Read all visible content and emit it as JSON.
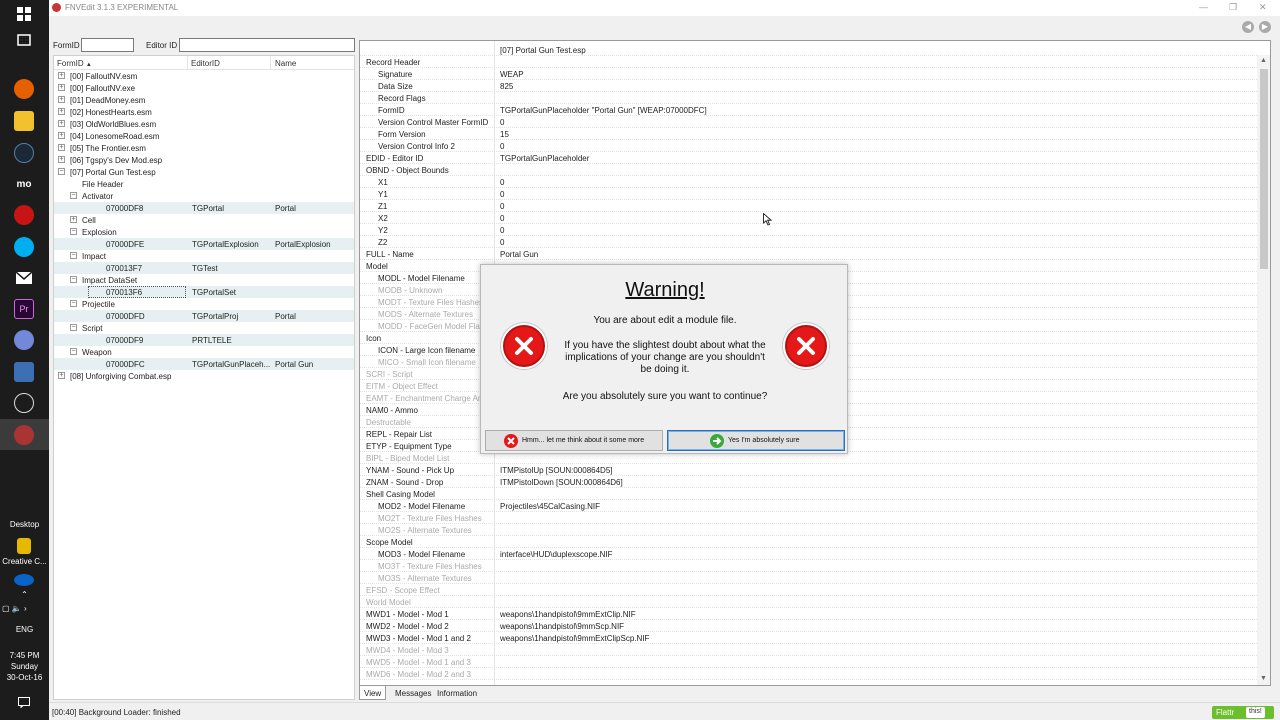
{
  "taskbar": {
    "desktop_label": "Desktop",
    "creative_label": "Creative C...",
    "language": "ENG",
    "time": "7:45 PM",
    "day": "Sunday",
    "date": "30-Oct-16",
    "chevron_up": "⌃",
    "chevron_right": "›"
  },
  "window": {
    "title": "FNVEdit 3.1.3 EXPERIMENTAL",
    "minimize": "—",
    "maximize": "❐",
    "close": "✕"
  },
  "toolbar": {
    "back": "◀",
    "forward": "▶"
  },
  "filter": {
    "formid_label": "FormID",
    "editorid_label": "Editor ID",
    "formid_value": "",
    "editorid_value": ""
  },
  "tree": {
    "columns": [
      "FormID",
      "EditorID",
      "Name"
    ],
    "sort_indicator": "▲",
    "rows": [
      {
        "exp": "+",
        "text": "[00] FalloutNV.esm",
        "editorid": "",
        "name": "",
        "level": 0
      },
      {
        "exp": "+",
        "text": "[00] FalloutNV.exe",
        "editorid": "",
        "name": "",
        "level": 0
      },
      {
        "exp": "+",
        "text": "[01] DeadMoney.esm",
        "editorid": "",
        "name": "",
        "level": 0
      },
      {
        "exp": "+",
        "text": "[02] HonestHearts.esm",
        "editorid": "",
        "name": "",
        "level": 0
      },
      {
        "exp": "+",
        "text": "[03] OldWorldBlues.esm",
        "editorid": "",
        "name": "",
        "level": 0
      },
      {
        "exp": "+",
        "text": "[04] LonesomeRoad.esm",
        "editorid": "",
        "name": "",
        "level": 0
      },
      {
        "exp": "+",
        "text": "[05] The Frontier.esm",
        "editorid": "",
        "name": "",
        "level": 0
      },
      {
        "exp": "+",
        "text": "[06] Tgspy's Dev Mod.esp",
        "editorid": "",
        "name": "",
        "level": 0
      },
      {
        "exp": "−",
        "text": "[07] Portal Gun Test.esp",
        "editorid": "",
        "name": "",
        "level": 0
      },
      {
        "exp": "",
        "text": "File Header",
        "editorid": "",
        "name": "",
        "level": 1
      },
      {
        "exp": "−",
        "text": "Activator",
        "editorid": "",
        "name": "",
        "level": 1
      },
      {
        "exp": "",
        "text": "07000DF8",
        "editorid": "TGPortal",
        "name": "Portal",
        "level": 2,
        "hl": true
      },
      {
        "exp": "+",
        "text": "Cell",
        "editorid": "",
        "name": "",
        "level": 1
      },
      {
        "exp": "−",
        "text": "Explosion",
        "editorid": "",
        "name": "",
        "level": 1
      },
      {
        "exp": "",
        "text": "07000DFE",
        "editorid": "TGPortalExplosion",
        "name": "PortalExplosion",
        "level": 2,
        "hl": true
      },
      {
        "exp": "−",
        "text": "Impact",
        "editorid": "",
        "name": "",
        "level": 1
      },
      {
        "exp": "",
        "text": "070013F7",
        "editorid": "TGTest",
        "name": "",
        "level": 2,
        "hl": true
      },
      {
        "exp": "−",
        "text": "Impact DataSet",
        "editorid": "",
        "name": "",
        "level": 1
      },
      {
        "exp": "",
        "text": "070013F6",
        "editorid": "TGPortalSet",
        "name": "",
        "level": 2,
        "hl": true,
        "focus": true
      },
      {
        "exp": "−",
        "text": "Projectile",
        "editorid": "",
        "name": "",
        "level": 1
      },
      {
        "exp": "",
        "text": "07000DFD",
        "editorid": "TGPortalProj",
        "name": "Portal",
        "level": 2,
        "hl": true
      },
      {
        "exp": "−",
        "text": "Script",
        "editorid": "",
        "name": "",
        "level": 1
      },
      {
        "exp": "",
        "text": "07000DF9",
        "editorid": "PRTLTELE",
        "name": "",
        "level": 2,
        "hl": true
      },
      {
        "exp": "−",
        "text": "Weapon",
        "editorid": "",
        "name": "",
        "level": 1
      },
      {
        "exp": "",
        "text": "07000DFC",
        "editorid": "TGPortalGunPlaceh...",
        "name": "Portal Gun",
        "level": 2,
        "hl": true
      },
      {
        "exp": "+",
        "text": "[08] Unforgiving Combat.esp",
        "editorid": "",
        "name": "",
        "level": 0
      }
    ]
  },
  "record": {
    "rows": [
      {
        "label": "",
        "value": "[07] Portal Gun Test.esp",
        "level": 0,
        "dim": false
      },
      {
        "label": "Record Header",
        "value": "",
        "level": 0,
        "dim": false
      },
      {
        "label": "Signature",
        "value": "WEAP",
        "level": 1,
        "dim": false
      },
      {
        "label": "Data Size",
        "value": "825",
        "level": 1,
        "dim": false
      },
      {
        "label": "Record Flags",
        "value": "",
        "level": 1,
        "dim": false
      },
      {
        "label": "FormID",
        "value": "TGPortalGunPlaceholder \"Portal Gun\" [WEAP:07000DFC]",
        "level": 1,
        "dim": false
      },
      {
        "label": "Version Control Master FormID",
        "value": "0",
        "level": 1,
        "dim": false
      },
      {
        "label": "Form Version",
        "value": "15",
        "level": 1,
        "dim": false
      },
      {
        "label": "Version Control Info 2",
        "value": "0",
        "level": 1,
        "dim": false
      },
      {
        "label": "EDID - Editor ID",
        "value": "TGPortalGunPlaceholder",
        "level": 0,
        "dim": false
      },
      {
        "label": "OBND - Object Bounds",
        "value": "",
        "level": 0,
        "dim": false
      },
      {
        "label": "X1",
        "value": "0",
        "level": 1,
        "dim": false
      },
      {
        "label": "Y1",
        "value": "0",
        "level": 1,
        "dim": false
      },
      {
        "label": "Z1",
        "value": "0",
        "level": 1,
        "dim": false
      },
      {
        "label": "X2",
        "value": "0",
        "level": 1,
        "dim": false
      },
      {
        "label": "Y2",
        "value": "0",
        "level": 1,
        "dim": false
      },
      {
        "label": "Z2",
        "value": "0",
        "level": 1,
        "dim": false
      },
      {
        "label": "FULL - Name",
        "value": "Portal Gun",
        "level": 0,
        "dim": false
      },
      {
        "label": "Model",
        "value": "",
        "level": 0,
        "dim": false
      },
      {
        "label": "MODL - Model Filename",
        "value": "",
        "level": 1,
        "dim": false
      },
      {
        "label": "MODB - Unknown",
        "value": "",
        "level": 1,
        "dim": true
      },
      {
        "label": "MODT - Texture Files Hashes",
        "value": "",
        "level": 1,
        "dim": true
      },
      {
        "label": "MODS - Alternate Textures",
        "value": "",
        "level": 1,
        "dim": true
      },
      {
        "label": "MODD - FaceGen Model Flags",
        "value": "",
        "level": 1,
        "dim": true
      },
      {
        "label": "Icon",
        "value": "",
        "level": 0,
        "dim": false
      },
      {
        "label": "ICON - Large Icon filename",
        "value": "",
        "level": 1,
        "dim": false
      },
      {
        "label": "MICO - Small Icon filename",
        "value": "",
        "level": 1,
        "dim": true
      },
      {
        "label": "SCRI - Script",
        "value": "",
        "level": 0,
        "dim": true
      },
      {
        "label": "EITM - Object Effect",
        "value": "",
        "level": 0,
        "dim": true
      },
      {
        "label": "EAMT - Enchantment Charge Amount",
        "value": "",
        "level": 0,
        "dim": true
      },
      {
        "label": "NAM0 - Ammo",
        "value": "",
        "level": 0,
        "dim": false
      },
      {
        "label": "Destructable",
        "value": "",
        "level": 0,
        "dim": true
      },
      {
        "label": "REPL - Repair List",
        "value": "",
        "level": 0,
        "dim": false
      },
      {
        "label": "ETYP - Equipment Type",
        "value": "",
        "level": 0,
        "dim": false
      },
      {
        "label": "BIPL - Biped Model List",
        "value": "",
        "level": 0,
        "dim": true
      },
      {
        "label": "YNAM - Sound - Pick Up",
        "value": "ITMPistolUp [SOUN:000864D5]",
        "level": 0,
        "dim": false
      },
      {
        "label": "ZNAM - Sound - Drop",
        "value": "ITMPistolDown [SOUN:000864D6]",
        "level": 0,
        "dim": false
      },
      {
        "label": "Shell Casing Model",
        "value": "",
        "level": 0,
        "dim": false
      },
      {
        "label": "MOD2 - Model Filename",
        "value": "Projectiles\\45CalCasing.NIF",
        "level": 1,
        "dim": false
      },
      {
        "label": "MO2T - Texture Files Hashes",
        "value": "",
        "level": 1,
        "dim": true
      },
      {
        "label": "MO2S - Alternate Textures",
        "value": "",
        "level": 1,
        "dim": true
      },
      {
        "label": "Scope Model",
        "value": "",
        "level": 0,
        "dim": false
      },
      {
        "label": "MOD3 - Model Filename",
        "value": "interface\\HUD\\duplexscope.NIF",
        "level": 1,
        "dim": false
      },
      {
        "label": "MO3T - Texture Files Hashes",
        "value": "",
        "level": 1,
        "dim": true
      },
      {
        "label": "MO3S - Alternate Textures",
        "value": "",
        "level": 1,
        "dim": true
      },
      {
        "label": "EFSD - Scope Effect",
        "value": "",
        "level": 0,
        "dim": true
      },
      {
        "label": "World Model",
        "value": "",
        "level": 0,
        "dim": true
      },
      {
        "label": "MWD1 - Model - Mod 1",
        "value": "weapons\\1handpistol\\9mmExtClip.NIF",
        "level": 0,
        "dim": false
      },
      {
        "label": "MWD2 - Model - Mod 2",
        "value": "weapons\\1handpistol\\9mmScp.NIF",
        "level": 0,
        "dim": false
      },
      {
        "label": "MWD3 - Model - Mod 1 and 2",
        "value": "weapons\\1handpistol\\9mmExtClipScp.NIF",
        "level": 0,
        "dim": false
      },
      {
        "label": "MWD4 - Model - Mod 3",
        "value": "",
        "level": 0,
        "dim": true
      },
      {
        "label": "MWD5 - Model - Mod 1 and 3",
        "value": "",
        "level": 0,
        "dim": true
      },
      {
        "label": "MWD6 - Model - Mod 2 and 3",
        "value": "",
        "level": 0,
        "dim": true
      }
    ]
  },
  "tabs": [
    "View",
    "Messages",
    "Information"
  ],
  "status": {
    "text": "[00:40] Background Loader: finished",
    "flattr_label": "Flattr",
    "flattr_this": "this!"
  },
  "dialog": {
    "title": "Warning!",
    "line1": "You are about edit a module file.",
    "line2": "If you have the slightest doubt about what the implications of your change are you shouldn't be doing it.",
    "line3": "Are you absolutely sure you want to continue?",
    "cancel_label": "Hmm... let me think about it some more",
    "confirm_label": "Yes I'm absolutely sure"
  },
  "colors": {
    "warning_red": "#e41818",
    "confirm_green": "#3aa83a",
    "highlight_row": "#e6f0f2",
    "flattr_green": "#6cbf2c"
  }
}
